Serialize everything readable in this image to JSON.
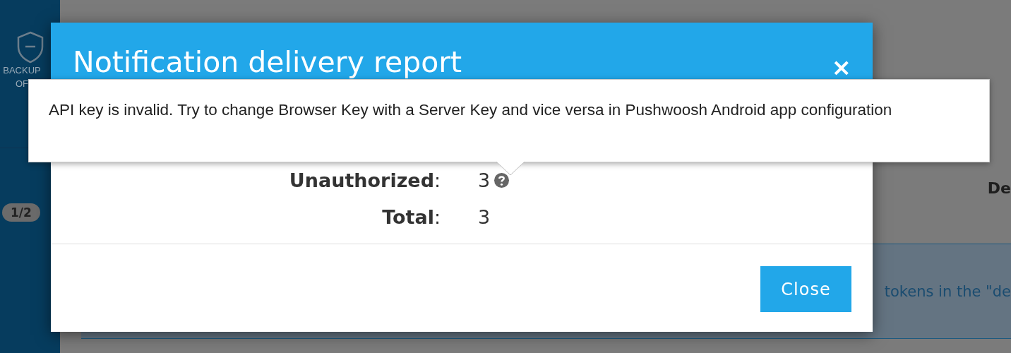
{
  "sidebar": {
    "backup_label": "BACKUP OF",
    "badge": "1/2"
  },
  "page": {
    "heading": "De",
    "alert_text": "tokens in the \"de"
  },
  "modal": {
    "title": "Notification delivery report",
    "close_icon": "×",
    "rows": [
      {
        "label": "Unauthorized",
        "separator": ":",
        "value": "3",
        "help": true
      },
      {
        "label": "Total",
        "separator": ":",
        "value": "3",
        "help": false
      }
    ],
    "button": "Close"
  },
  "tooltip": {
    "text": "API key is invalid. Try to change Browser Key with a Server Key and vice versa in Pushwoosh Android app configuration"
  }
}
